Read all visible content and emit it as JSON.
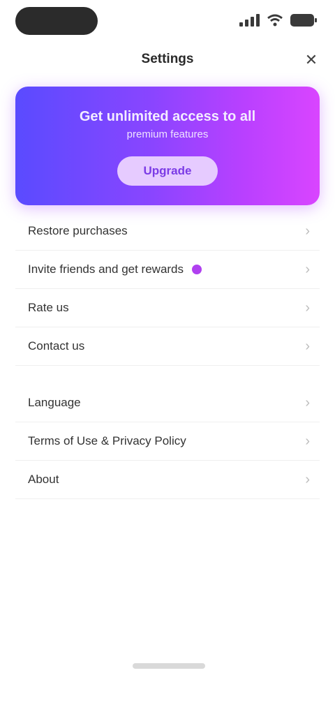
{
  "header": {
    "title": "Settings",
    "close_icon": "close-icon"
  },
  "promo": {
    "title": "Get unlimited access to all",
    "subtitle": "premium features",
    "button_label": "Upgrade",
    "gradient_start": "#5a4bff",
    "gradient_end": "#d945ff"
  },
  "settings": {
    "group1": [
      {
        "label": "Restore purchases"
      },
      {
        "label": "Invite friends and get rewards",
        "badge": true,
        "badge_color": "#b040f0"
      },
      {
        "label": "Rate us"
      },
      {
        "label": "Contact us"
      }
    ],
    "group2": [
      {
        "label": "Language"
      },
      {
        "label": "Terms of Use & Privacy Policy"
      },
      {
        "label": "About"
      }
    ]
  }
}
